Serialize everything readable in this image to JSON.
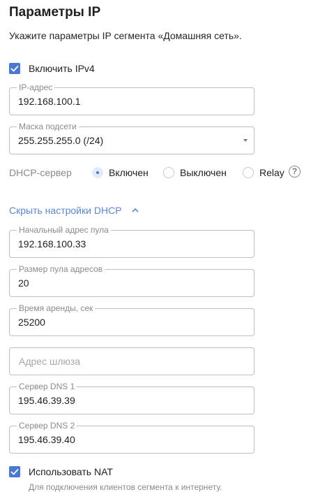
{
  "header": {
    "title": "Параметры IP",
    "subtitle": "Укажите параметры IP сегмента «Домашняя сеть»."
  },
  "ipv4": {
    "label": "Включить IPv4",
    "checked": true
  },
  "ip_address": {
    "label": "IP-адрес",
    "value": "192.168.100.1"
  },
  "subnet_mask": {
    "label": "Маска подсети",
    "value": "255.255.255.0 (/24)"
  },
  "dhcp": {
    "label": "DHCP-сервер",
    "options": [
      {
        "label": "Включен",
        "selected": true
      },
      {
        "label": "Выключен",
        "selected": false
      },
      {
        "label": "Relay",
        "selected": false
      }
    ],
    "help_icon": "question-circle-icon",
    "toggle_label": "Скрыть настройки DHCP"
  },
  "pool_start": {
    "label": "Начальный адрес пула",
    "value": "192.168.100.33"
  },
  "pool_size": {
    "label": "Размер пула адресов",
    "value": "20"
  },
  "lease_time": {
    "label": "Время аренды, сек",
    "value": "25200"
  },
  "gateway": {
    "placeholder": "Адрес шлюза",
    "value": ""
  },
  "dns1": {
    "label": "Сервер DNS 1",
    "value": "195.46.39.39"
  },
  "dns2": {
    "label": "Сервер DNS 2",
    "value": "195.46.39.40"
  },
  "nat": {
    "label": "Использовать NAT",
    "checked": true,
    "hint": "Для подключения клиентов сегмента к интернету."
  },
  "colors": {
    "accent": "#4a79d4",
    "link": "#5b86d8",
    "border": "#bdbdbd",
    "muted_text": "#8a8a8a"
  }
}
